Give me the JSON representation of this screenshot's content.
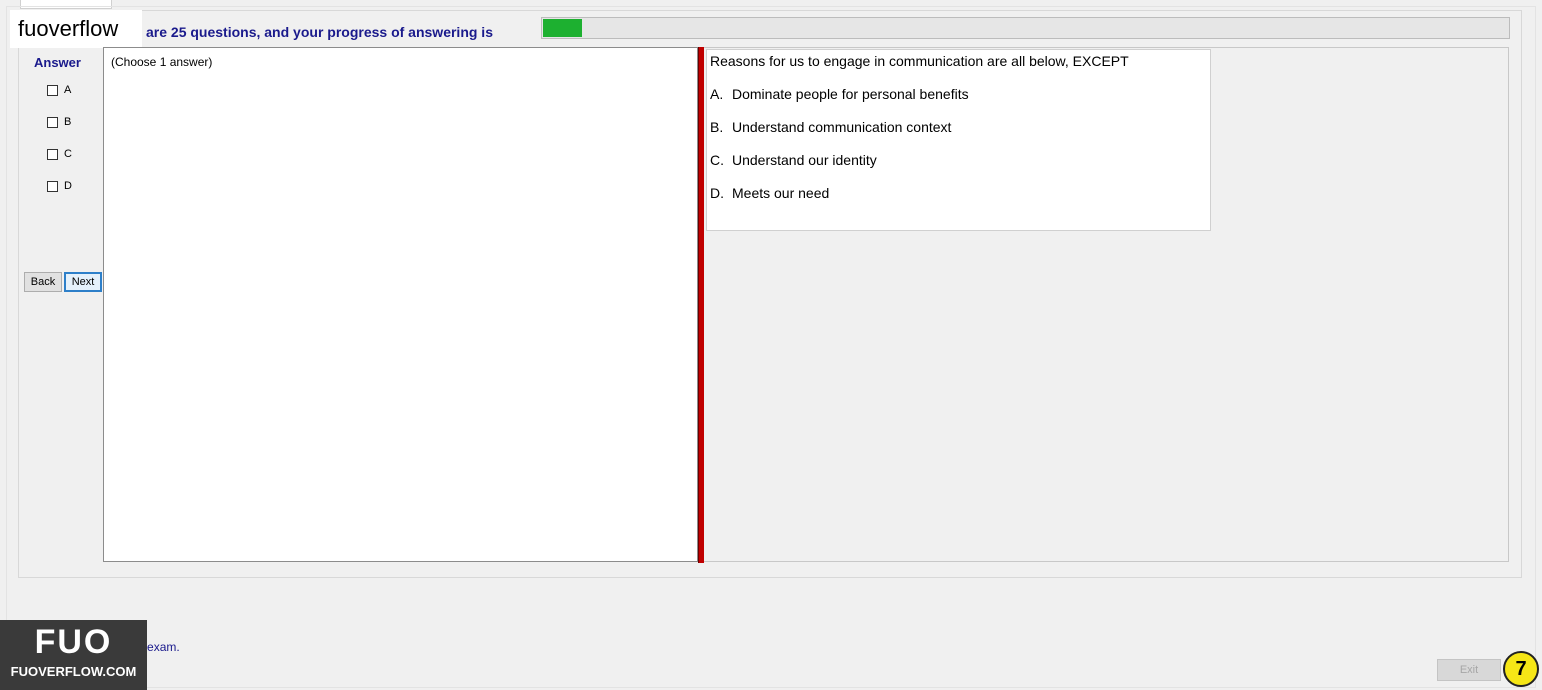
{
  "brand": "fuoverflow",
  "progress": {
    "text": "are 25 questions, and your progress of answering is",
    "fraction": 0.04
  },
  "answer_panel": {
    "title": "Answer",
    "options": [
      "A",
      "B",
      "C",
      "D"
    ],
    "back_label": "Back",
    "next_label": "Next"
  },
  "choose_hint": "(Choose 1 answer)",
  "question": {
    "text": "Reasons for us to engage in communication are all below, EXCEPT",
    "options": [
      {
        "letter": "A.",
        "text": "Dominate people for personal benefits"
      },
      {
        "letter": "B.",
        "text": "Understand communication context"
      },
      {
        "letter": "C.",
        "text": "Understand our identity"
      },
      {
        "letter": "D.",
        "text": "Meets our need"
      }
    ]
  },
  "footer": {
    "finish_text": "I want to finish the exam.",
    "exit_label": "Exit",
    "page_number": "7"
  },
  "logo": {
    "mark": "FUO",
    "sub": "FUOVERFLOW.COM"
  },
  "colors": {
    "accent_text": "#1a1a8c",
    "progress_fill": "#1db030",
    "divider": "#c00000"
  }
}
